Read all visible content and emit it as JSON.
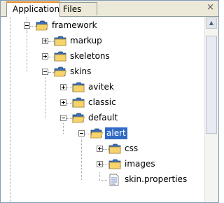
{
  "tabs": [
    {
      "label": "Application",
      "active": true
    },
    {
      "label": "Files",
      "active": false
    }
  ],
  "close_glyph": "×",
  "tree": [
    {
      "label": "framework",
      "depth": 0,
      "expanded": true,
      "icon": "folder-open-icon"
    },
    {
      "label": "markup",
      "depth": 1,
      "expanded": false,
      "icon": "folder-icon"
    },
    {
      "label": "skeletons",
      "depth": 1,
      "expanded": false,
      "icon": "folder-icon"
    },
    {
      "label": "skins",
      "depth": 1,
      "expanded": true,
      "icon": "folder-open-icon"
    },
    {
      "label": "avitek",
      "depth": 2,
      "expanded": false,
      "icon": "folder-icon"
    },
    {
      "label": "classic",
      "depth": 2,
      "expanded": false,
      "icon": "folder-icon"
    },
    {
      "label": "default",
      "depth": 2,
      "expanded": true,
      "icon": "folder-open-icon"
    },
    {
      "label": "alert",
      "depth": 3,
      "expanded": true,
      "selected": true,
      "icon": "folder-open-icon"
    },
    {
      "label": "css",
      "depth": 4,
      "expanded": false,
      "icon": "folder-icon"
    },
    {
      "label": "images",
      "depth": 4,
      "expanded": false,
      "icon": "folder-icon"
    },
    {
      "label": "skin.properties",
      "depth": 4,
      "file": true,
      "icon": "file-icon"
    }
  ],
  "colors": {
    "folder": "#f7d36b",
    "folder_edge": "#b08a2e",
    "folder_tab": "#3a6fb5",
    "selection": "#316ac5",
    "tab_accent": "#e68b2c"
  }
}
